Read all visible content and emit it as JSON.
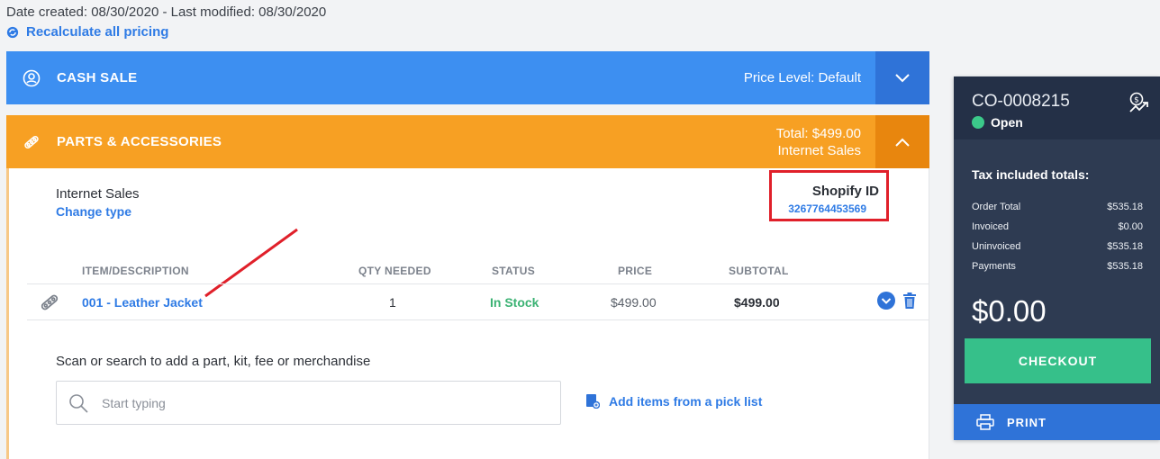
{
  "header": {
    "dates": "Date created: 08/30/2020 - Last modified: 08/30/2020",
    "recalculate_label": "Recalculate all pricing"
  },
  "cash_sale": {
    "title": "CASH SALE",
    "price_level": "Price Level: Default"
  },
  "parts": {
    "title": "PARTS & ACCESSORIES",
    "total": "Total: $499.00",
    "type_label": "Internet Sales",
    "sale_type": "Internet Sales",
    "change_type": "Change type",
    "shopify_label": "Shopify ID",
    "shopify_id": "3267764453569",
    "columns": {
      "item": "ITEM/DESCRIPTION",
      "qty": "QTY NEEDED",
      "status": "STATUS",
      "price": "PRICE",
      "subtotal": "SUBTOTAL"
    },
    "rows": [
      {
        "item": "001 - Leather Jacket",
        "qty": "1",
        "status": "In Stock",
        "price": "$499.00",
        "subtotal": "$499.00"
      }
    ],
    "scan_label": "Scan or search to add a part, kit, fee or merchandise",
    "search_placeholder": "Start typing",
    "picklist_label": "Add items from a pick list"
  },
  "summary": {
    "order_number": "CO-0008215",
    "status": "Open",
    "tax_title": "Tax included totals:",
    "rows": [
      {
        "label": "Order Total",
        "value": "$535.18"
      },
      {
        "label": "Invoiced",
        "value": "$0.00"
      },
      {
        "label": "Uninvoiced",
        "value": "$535.18"
      },
      {
        "label": "Payments",
        "value": "$535.18"
      }
    ],
    "balance": "$0.00",
    "checkout_label": "CHECKOUT",
    "print_label": "PRINT"
  },
  "colors": {
    "blue_bar": "#3d8ff1",
    "orange_bar": "#f7a023",
    "link": "#2f7be5",
    "in_stock": "#3bb273",
    "checkout": "#36c08a",
    "sidebar": "#2e3b52",
    "highlight_box": "#e0202a"
  },
  "icons": [
    "refresh-icon",
    "customer-icon",
    "chevron-down-icon",
    "parts-icon",
    "chevron-up-icon",
    "search-icon",
    "picklist-icon",
    "trash-icon",
    "price-trend-icon",
    "printer-icon"
  ]
}
